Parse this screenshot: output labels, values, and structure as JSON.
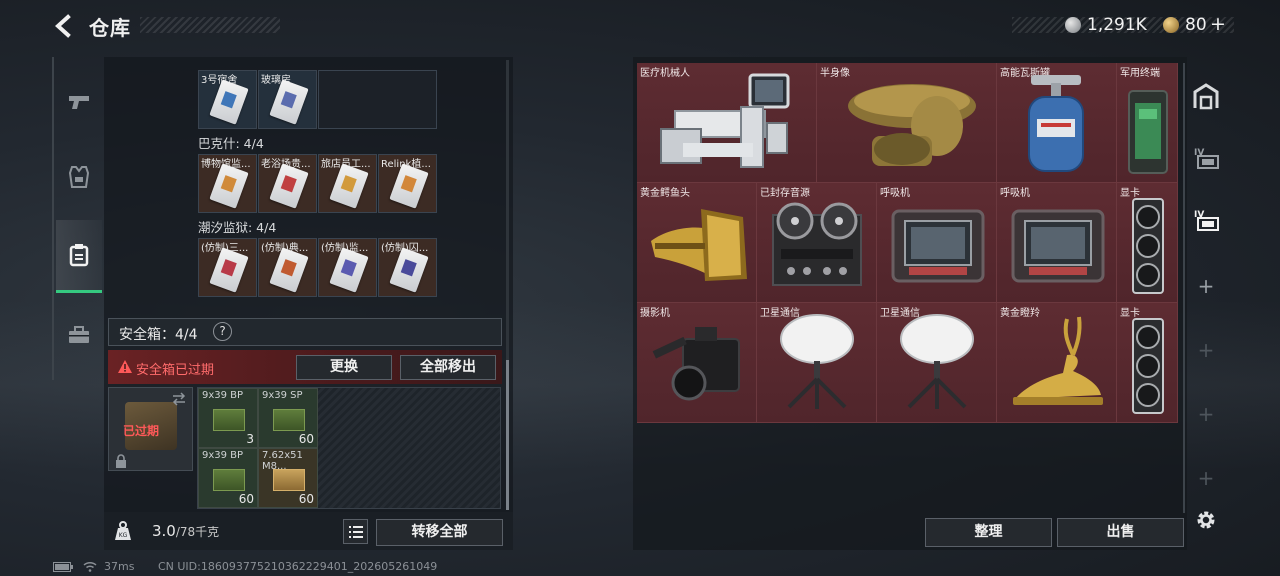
{
  "header": {
    "title": "仓库",
    "currency1": "1,291K",
    "currency2": "80",
    "currency2_add": "+"
  },
  "sidebar": {
    "items": [
      {
        "name": "weapons-tab",
        "icon": "pistol-icon",
        "active": false
      },
      {
        "name": "gear-tab",
        "icon": "armor-vest-icon",
        "active": false
      },
      {
        "name": "container-tab",
        "icon": "clipboard-icon",
        "active": true
      },
      {
        "name": "case-tab",
        "icon": "briefcase-icon",
        "active": false
      }
    ]
  },
  "keys": {
    "top_row": [
      "3号宿舍",
      "玻璃房"
    ],
    "groups": [
      {
        "label": "巴克什: 4/4",
        "items": [
          "博物馆监...",
          "老浴场贵...",
          "旅店员工...",
          "Relink植..."
        ]
      },
      {
        "label": "潮汐监狱: 4/4",
        "items": [
          "(仿制)三...",
          "(仿制)典...",
          "(仿制)监...",
          "(仿制)囚..."
        ]
      }
    ]
  },
  "safe": {
    "header": "安全箱：4/4",
    "help": "?",
    "expired_msg": "安全箱已过期",
    "replace_btn": "更换",
    "move_all_btn": "全部移出",
    "box_label": "已过期",
    "ammo": [
      {
        "name": "9x39 BP",
        "count": "3"
      },
      {
        "name": "9x39 SP",
        "count": "60"
      },
      {
        "name": "9x39 BP",
        "count": "60"
      },
      {
        "name": "7.62x51 M8...",
        "count": "60"
      }
    ]
  },
  "bottom": {
    "weight": "3.0",
    "weight_cap": "/78千克",
    "transfer_btn": "转移全部"
  },
  "footer": {
    "ping": "37ms",
    "uid": "CN UID:186093775210362229401_202605261049"
  },
  "stash": {
    "items": [
      {
        "name": "医疗机械人",
        "icon": "medical-robot-icon"
      },
      {
        "name": "半身像",
        "icon": "bust-statue-icon"
      },
      {
        "name": "高能瓦斯罐",
        "icon": "gas-canister-icon"
      },
      {
        "name": "军用终端",
        "icon": "military-terminal-icon"
      },
      {
        "name": "黄金鳄鱼头",
        "icon": "golden-crocodile-head-icon"
      },
      {
        "name": "已封存音源",
        "icon": "reel-recorder-icon"
      },
      {
        "name": "呼吸机",
        "icon": "ventilator-icon"
      },
      {
        "name": "呼吸机",
        "icon": "ventilator-icon"
      },
      {
        "name": "显卡",
        "icon": "graphics-card-icon"
      },
      {
        "name": "摄影机",
        "icon": "camera-icon"
      },
      {
        "name": "卫星通信",
        "icon": "satellite-dish-icon"
      },
      {
        "name": "卫星通信",
        "icon": "satellite-dish-icon"
      },
      {
        "name": "黄金瞪羚",
        "icon": "golden-gazelle-icon"
      },
      {
        "name": "显卡",
        "icon": "graphics-card-icon"
      }
    ],
    "sort_btn": "整理",
    "sell_btn": "出售"
  },
  "colors": {
    "accent_green": "#35c980",
    "expired_red": "#ff5959",
    "stash_bg": "#5a2a30"
  }
}
